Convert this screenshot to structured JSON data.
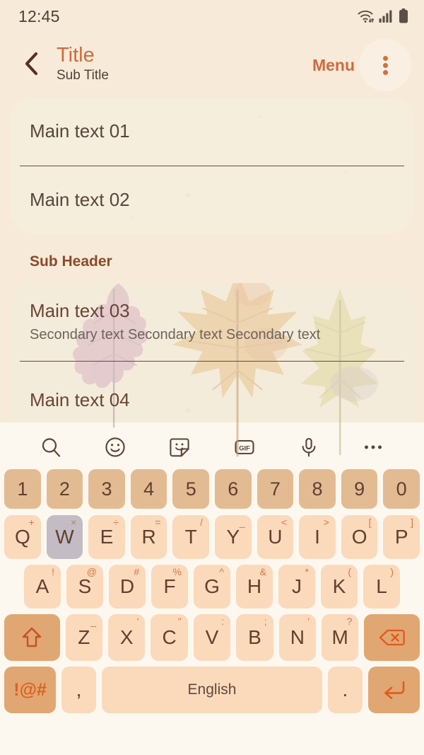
{
  "status_bar": {
    "time": "12:45",
    "icons": [
      "wifi-icon",
      "signal-icon",
      "battery-icon"
    ]
  },
  "app_bar": {
    "back_icon": "chevron-left-icon",
    "title": "Title",
    "subtitle": "Sub Title",
    "menu_label": "Menu",
    "overflow_icon": "more-vertical-icon",
    "title_color": "#cf6b3f"
  },
  "content": {
    "card_1": {
      "items": [
        {
          "main": "Main text 01"
        },
        {
          "main": "Main text 02"
        }
      ]
    },
    "sub_header": "Sub Header",
    "card_2": {
      "items": [
        {
          "main": "Main text 03",
          "secondary": "Secondary text Secondary text Secondary text"
        },
        {
          "main": "Main text 04"
        }
      ]
    }
  },
  "keyboard": {
    "toolbar": [
      {
        "name": "search-icon"
      },
      {
        "name": "emoji-icon"
      },
      {
        "name": "sticker-icon"
      },
      {
        "name": "gif-icon",
        "label": "GIF"
      },
      {
        "name": "microphone-icon"
      },
      {
        "name": "more-horizontal-icon"
      }
    ],
    "row_numbers": [
      "1",
      "2",
      "3",
      "4",
      "5",
      "6",
      "7",
      "8",
      "9",
      "0"
    ],
    "row_1": [
      {
        "key": "Q",
        "sup": "+"
      },
      {
        "key": "W",
        "sup": "×",
        "pressed": true
      },
      {
        "key": "E",
        "sup": "÷"
      },
      {
        "key": "R",
        "sup": "="
      },
      {
        "key": "T",
        "sup": "/"
      },
      {
        "key": "Y",
        "sup": "_"
      },
      {
        "key": "U",
        "sup": "<"
      },
      {
        "key": "I",
        "sup": ">"
      },
      {
        "key": "O",
        "sup": "["
      },
      {
        "key": "P",
        "sup": "]"
      }
    ],
    "row_2": [
      {
        "key": "A",
        "sup": "!"
      },
      {
        "key": "S",
        "sup": "@"
      },
      {
        "key": "D",
        "sup": "#"
      },
      {
        "key": "F",
        "sup": "%"
      },
      {
        "key": "G",
        "sup": "^"
      },
      {
        "key": "H",
        "sup": "&"
      },
      {
        "key": "J",
        "sup": "*"
      },
      {
        "key": "K",
        "sup": "("
      },
      {
        "key": "L",
        "sup": ")"
      }
    ],
    "row_3": [
      {
        "key": "Z",
        "sup": "_"
      },
      {
        "key": "X",
        "sup": "'"
      },
      {
        "key": "C",
        "sup": "\""
      },
      {
        "key": "V",
        "sup": ":"
      },
      {
        "key": "B",
        "sup": ";"
      },
      {
        "key": "N",
        "sup": "'"
      },
      {
        "key": "M",
        "sup": "?"
      }
    ],
    "shift_icon": "shift-arrow-icon",
    "backspace_icon": "backspace-icon",
    "row_4": {
      "symbols_label": "!@#",
      "comma": ",",
      "space_label": "English",
      "period": ".",
      "enter_icon": "enter-arrow-icon"
    }
  },
  "colors": {
    "page_background": "#f7ead8",
    "card_background": "#f6eedd",
    "keyboard_background": "#fdf8ef",
    "key_letter": "#fbd9bb",
    "key_number": "#e3bb93",
    "key_accent": "#e0a772",
    "key_pressed": "#c3bcc4",
    "accent_orange": "#cf6b3f",
    "symbol_orange": "#df5f20"
  }
}
